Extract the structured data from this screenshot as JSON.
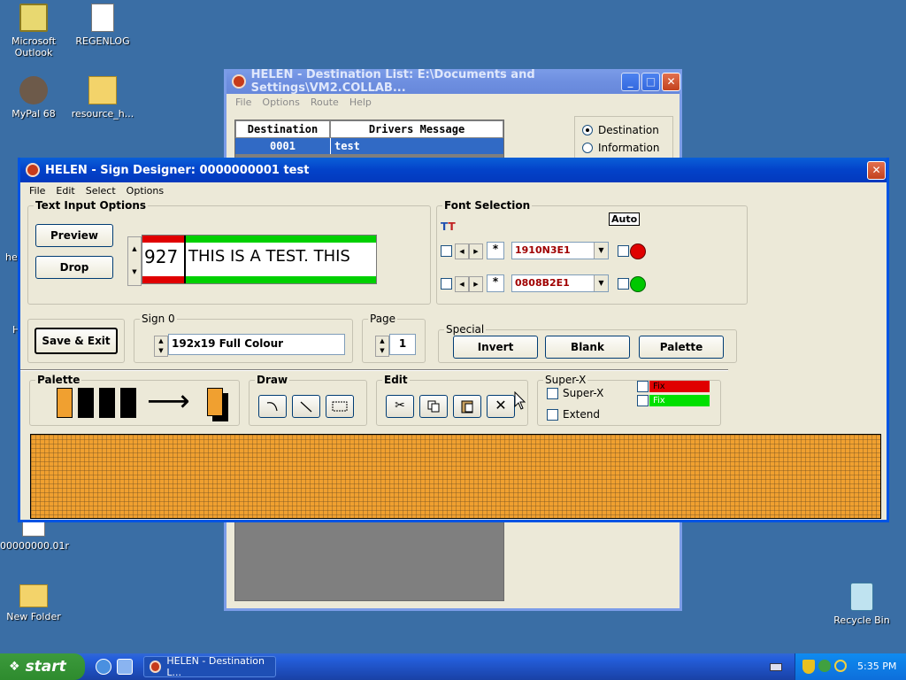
{
  "desktop": {
    "icons": [
      {
        "label": "Microsoft\nOutlook"
      },
      {
        "label": "REGENLOG"
      },
      {
        "label": "MyPal 68"
      },
      {
        "label": "resource_h..."
      },
      {
        "label": "00000000.01r"
      },
      {
        "label": "New Folder"
      },
      {
        "label": "Recycle Bin"
      }
    ],
    "fragments": [
      "he",
      "H"
    ]
  },
  "dest_window": {
    "title": "HELEN - Destination List: E:\\Documents and Settings\\VM2.COLLAB...",
    "menu": [
      "File",
      "Options",
      "Route",
      "Help"
    ],
    "columns": [
      "Destination",
      "Drivers Message"
    ],
    "rows": [
      {
        "destination": "0001",
        "message": "test"
      }
    ],
    "radios": [
      "Destination",
      "Information"
    ]
  },
  "sign_window": {
    "title": "HELEN - Sign Designer: 0000000001 test",
    "menu": [
      "File",
      "Edit",
      "Select",
      "Options"
    ],
    "text_input": {
      "label": "Text Input Options",
      "preview": "Preview",
      "drop": "Drop",
      "number": "927",
      "text": "THIS IS A TEST. THIS"
    },
    "font": {
      "label": "Font Selection",
      "auto": "Auto",
      "fonts": [
        {
          "star": "*",
          "name": "1910N3E1",
          "color": "#e00000"
        },
        {
          "star": "*",
          "name": "0808B2E1",
          "color": "#00c800"
        }
      ]
    },
    "save_exit": "Save & Exit",
    "sign": {
      "label": "Sign 0",
      "value": "192x19 Full Colour"
    },
    "page": {
      "label": "Page",
      "value": "1"
    },
    "special": {
      "label": "Special",
      "buttons": [
        "Invert",
        "Blank",
        "Palette"
      ]
    },
    "palette": {
      "label": "Palette",
      "arrow": "⟶"
    },
    "draw": {
      "label": "Draw"
    },
    "edit": {
      "label": "Edit"
    },
    "superx": {
      "label": "Super-X",
      "options": [
        "Super-X",
        "Extend"
      ],
      "fix1": "Fix",
      "fix2": "Fix"
    },
    "canvas": {
      "color": "#f0a030",
      "grid": "#705020"
    }
  },
  "taskbar": {
    "start": "start",
    "task": "HELEN - Destination L...",
    "clock": "5:35 PM"
  }
}
